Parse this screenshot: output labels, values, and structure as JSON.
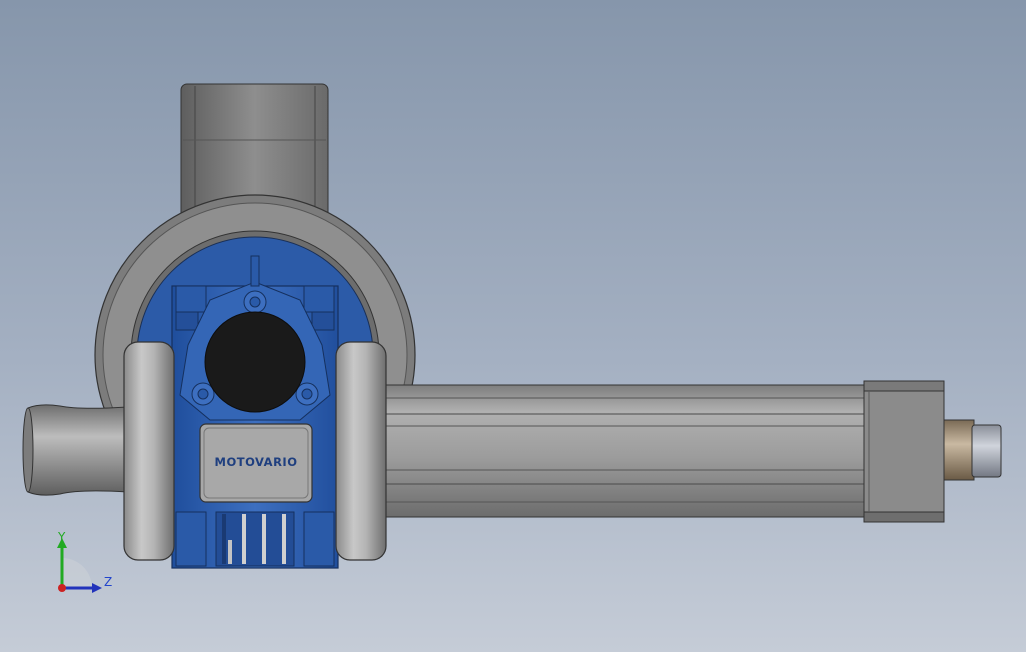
{
  "viewport": {
    "background_top": "#8696ab",
    "background_bottom": "#c5ccd7"
  },
  "model": {
    "gearbox_brand": "MOTOVARIO",
    "gearbox_color": "#2f5fae",
    "housing_color": "#8c8c8c",
    "tube_color": "#9a9a9a"
  },
  "triad": {
    "y_label": "Y",
    "z_label": "Z",
    "y_color": "#22aa22",
    "z_color": "#2233bb",
    "x_color": "#cc2222"
  }
}
